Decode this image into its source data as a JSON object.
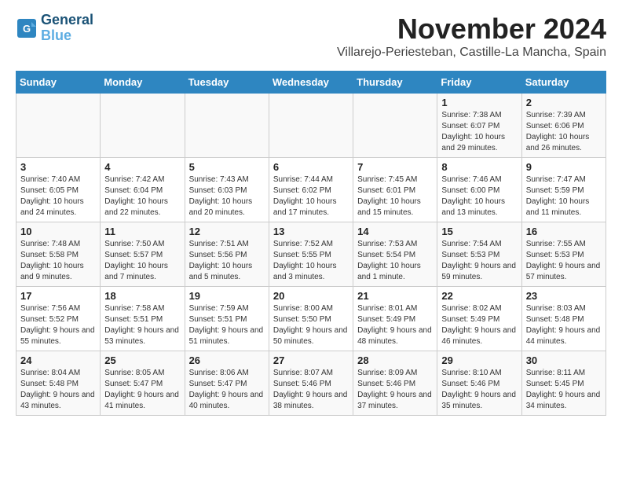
{
  "header": {
    "logo_line1": "General",
    "logo_line2": "Blue",
    "month_title": "November 2024",
    "location": "Villarejo-Periesteban, Castille-La Mancha, Spain"
  },
  "weekdays": [
    "Sunday",
    "Monday",
    "Tuesday",
    "Wednesday",
    "Thursday",
    "Friday",
    "Saturday"
  ],
  "weeks": [
    [
      {
        "day": "",
        "info": ""
      },
      {
        "day": "",
        "info": ""
      },
      {
        "day": "",
        "info": ""
      },
      {
        "day": "",
        "info": ""
      },
      {
        "day": "",
        "info": ""
      },
      {
        "day": "1",
        "info": "Sunrise: 7:38 AM\nSunset: 6:07 PM\nDaylight: 10 hours and 29 minutes."
      },
      {
        "day": "2",
        "info": "Sunrise: 7:39 AM\nSunset: 6:06 PM\nDaylight: 10 hours and 26 minutes."
      }
    ],
    [
      {
        "day": "3",
        "info": "Sunrise: 7:40 AM\nSunset: 6:05 PM\nDaylight: 10 hours and 24 minutes."
      },
      {
        "day": "4",
        "info": "Sunrise: 7:42 AM\nSunset: 6:04 PM\nDaylight: 10 hours and 22 minutes."
      },
      {
        "day": "5",
        "info": "Sunrise: 7:43 AM\nSunset: 6:03 PM\nDaylight: 10 hours and 20 minutes."
      },
      {
        "day": "6",
        "info": "Sunrise: 7:44 AM\nSunset: 6:02 PM\nDaylight: 10 hours and 17 minutes."
      },
      {
        "day": "7",
        "info": "Sunrise: 7:45 AM\nSunset: 6:01 PM\nDaylight: 10 hours and 15 minutes."
      },
      {
        "day": "8",
        "info": "Sunrise: 7:46 AM\nSunset: 6:00 PM\nDaylight: 10 hours and 13 minutes."
      },
      {
        "day": "9",
        "info": "Sunrise: 7:47 AM\nSunset: 5:59 PM\nDaylight: 10 hours and 11 minutes."
      }
    ],
    [
      {
        "day": "10",
        "info": "Sunrise: 7:48 AM\nSunset: 5:58 PM\nDaylight: 10 hours and 9 minutes."
      },
      {
        "day": "11",
        "info": "Sunrise: 7:50 AM\nSunset: 5:57 PM\nDaylight: 10 hours and 7 minutes."
      },
      {
        "day": "12",
        "info": "Sunrise: 7:51 AM\nSunset: 5:56 PM\nDaylight: 10 hours and 5 minutes."
      },
      {
        "day": "13",
        "info": "Sunrise: 7:52 AM\nSunset: 5:55 PM\nDaylight: 10 hours and 3 minutes."
      },
      {
        "day": "14",
        "info": "Sunrise: 7:53 AM\nSunset: 5:54 PM\nDaylight: 10 hours and 1 minute."
      },
      {
        "day": "15",
        "info": "Sunrise: 7:54 AM\nSunset: 5:53 PM\nDaylight: 9 hours and 59 minutes."
      },
      {
        "day": "16",
        "info": "Sunrise: 7:55 AM\nSunset: 5:53 PM\nDaylight: 9 hours and 57 minutes."
      }
    ],
    [
      {
        "day": "17",
        "info": "Sunrise: 7:56 AM\nSunset: 5:52 PM\nDaylight: 9 hours and 55 minutes."
      },
      {
        "day": "18",
        "info": "Sunrise: 7:58 AM\nSunset: 5:51 PM\nDaylight: 9 hours and 53 minutes."
      },
      {
        "day": "19",
        "info": "Sunrise: 7:59 AM\nSunset: 5:51 PM\nDaylight: 9 hours and 51 minutes."
      },
      {
        "day": "20",
        "info": "Sunrise: 8:00 AM\nSunset: 5:50 PM\nDaylight: 9 hours and 50 minutes."
      },
      {
        "day": "21",
        "info": "Sunrise: 8:01 AM\nSunset: 5:49 PM\nDaylight: 9 hours and 48 minutes."
      },
      {
        "day": "22",
        "info": "Sunrise: 8:02 AM\nSunset: 5:49 PM\nDaylight: 9 hours and 46 minutes."
      },
      {
        "day": "23",
        "info": "Sunrise: 8:03 AM\nSunset: 5:48 PM\nDaylight: 9 hours and 44 minutes."
      }
    ],
    [
      {
        "day": "24",
        "info": "Sunrise: 8:04 AM\nSunset: 5:48 PM\nDaylight: 9 hours and 43 minutes."
      },
      {
        "day": "25",
        "info": "Sunrise: 8:05 AM\nSunset: 5:47 PM\nDaylight: 9 hours and 41 minutes."
      },
      {
        "day": "26",
        "info": "Sunrise: 8:06 AM\nSunset: 5:47 PM\nDaylight: 9 hours and 40 minutes."
      },
      {
        "day": "27",
        "info": "Sunrise: 8:07 AM\nSunset: 5:46 PM\nDaylight: 9 hours and 38 minutes."
      },
      {
        "day": "28",
        "info": "Sunrise: 8:09 AM\nSunset: 5:46 PM\nDaylight: 9 hours and 37 minutes."
      },
      {
        "day": "29",
        "info": "Sunrise: 8:10 AM\nSunset: 5:46 PM\nDaylight: 9 hours and 35 minutes."
      },
      {
        "day": "30",
        "info": "Sunrise: 8:11 AM\nSunset: 5:45 PM\nDaylight: 9 hours and 34 minutes."
      }
    ]
  ]
}
